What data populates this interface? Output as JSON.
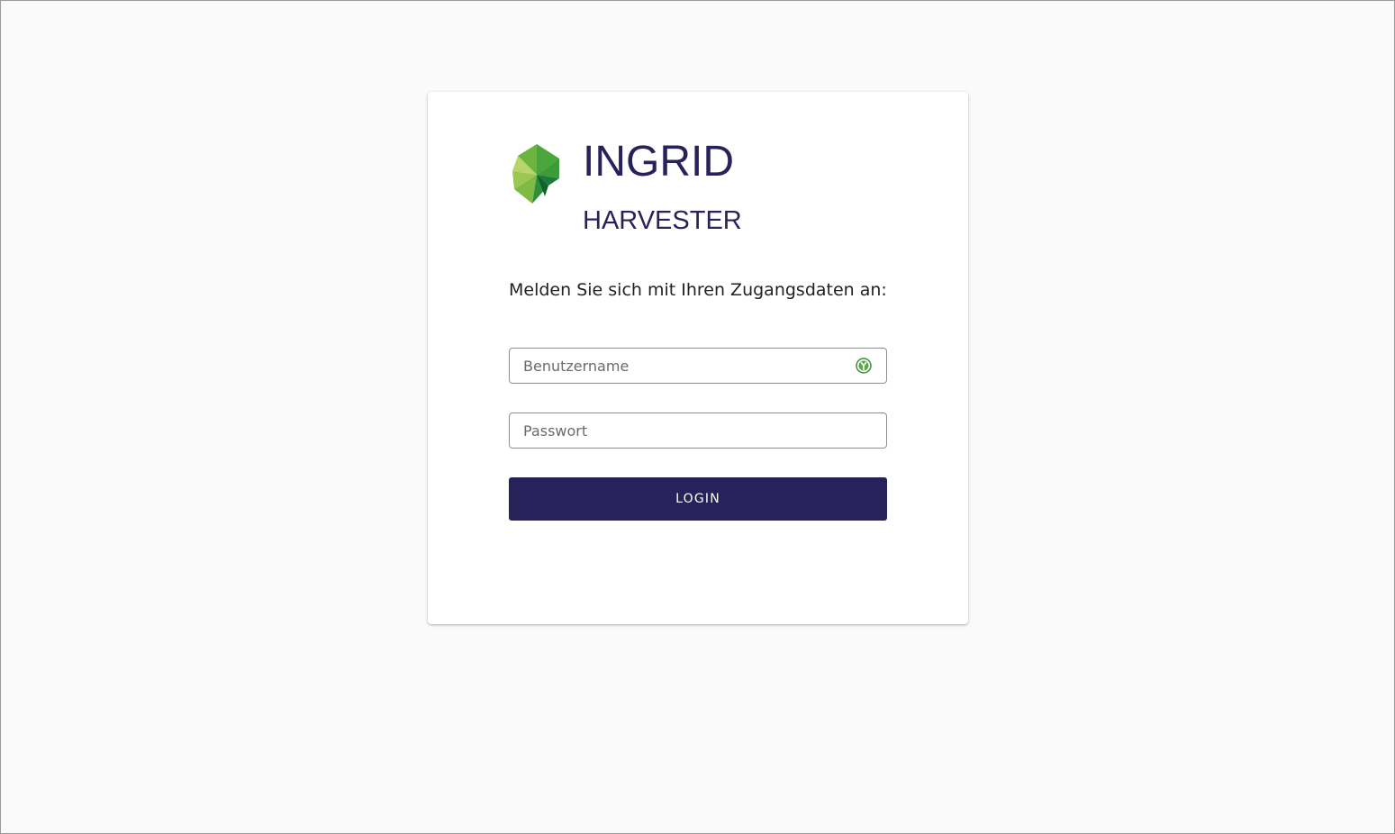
{
  "brand": {
    "title": "INGRID",
    "subtitle": "HARVESTER",
    "logo_icon": "ingrid-leaf-logo-icon",
    "colors": {
      "primary": "#272259",
      "leaf_light": "#a6cc55",
      "leaf_mid": "#6db33f",
      "leaf_dark": "#1a7a3a"
    }
  },
  "login": {
    "intro": "Melden Sie sich mit Ihren Zugangsdaten an:",
    "username_placeholder": "Benutzername",
    "password_placeholder": "Passwort",
    "password_manager_icon": "password-manager-icon",
    "button_label": "LOGIN"
  }
}
